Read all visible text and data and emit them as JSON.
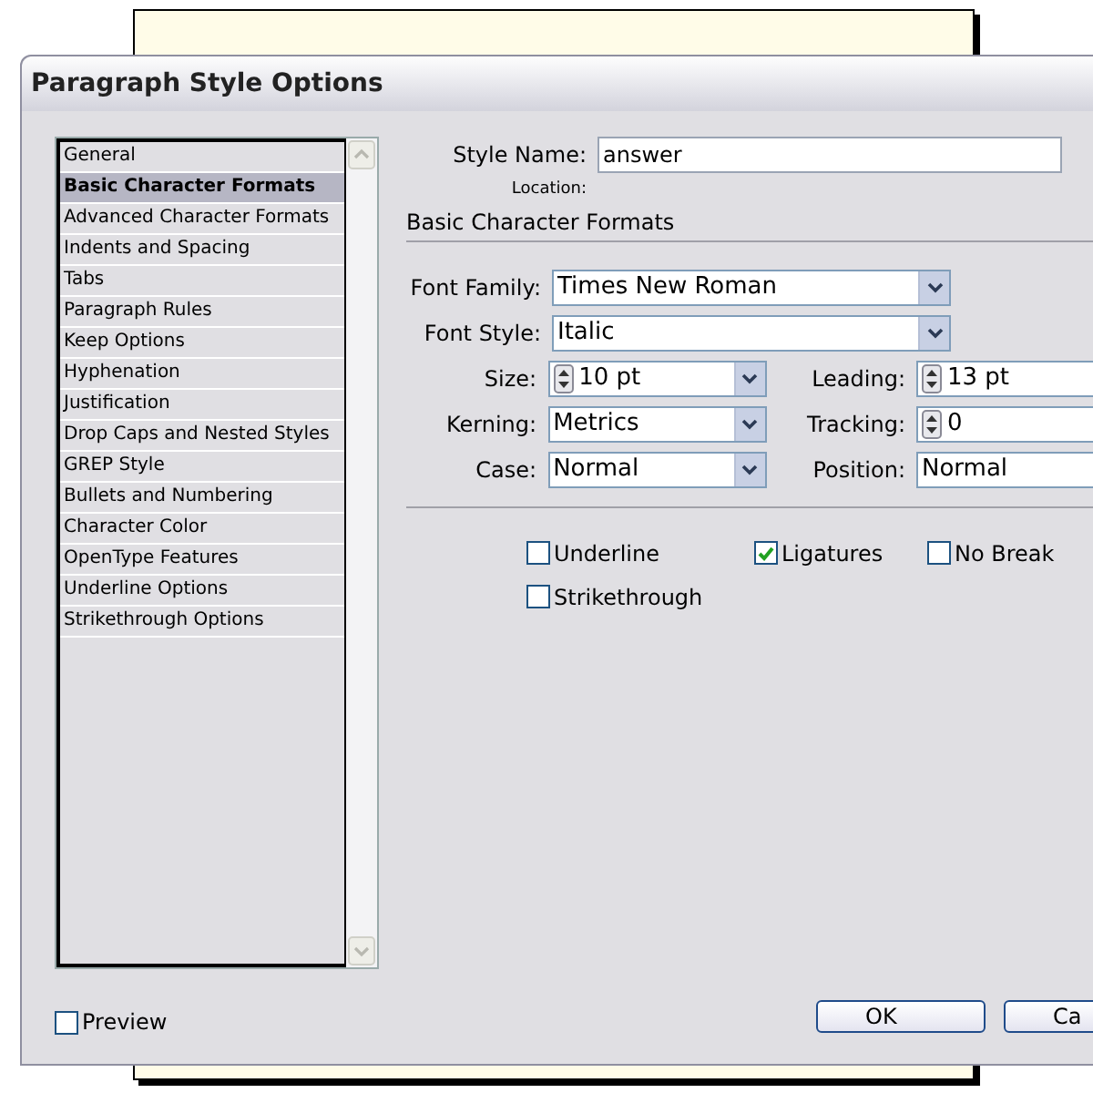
{
  "window": {
    "title": "Paragraph Style Options"
  },
  "categories": [
    {
      "label": "General",
      "selected": false
    },
    {
      "label": "Basic Character Formats",
      "selected": true
    },
    {
      "label": "Advanced Character Formats",
      "selected": false
    },
    {
      "label": "Indents and Spacing",
      "selected": false
    },
    {
      "label": "Tabs",
      "selected": false
    },
    {
      "label": "Paragraph Rules",
      "selected": false
    },
    {
      "label": "Keep Options",
      "selected": false
    },
    {
      "label": "Hyphenation",
      "selected": false
    },
    {
      "label": "Justification",
      "selected": false
    },
    {
      "label": "Drop Caps and Nested Styles",
      "selected": false
    },
    {
      "label": "GREP Style",
      "selected": false
    },
    {
      "label": "Bullets and Numbering",
      "selected": false
    },
    {
      "label": "Character Color",
      "selected": false
    },
    {
      "label": "OpenType Features",
      "selected": false
    },
    {
      "label": "Underline Options",
      "selected": false
    },
    {
      "label": "Strikethrough Options",
      "selected": false
    }
  ],
  "style_name": {
    "label": "Style Name:",
    "value": "answer"
  },
  "location": {
    "label": "Location:"
  },
  "section_title": "Basic Character Formats",
  "font_fields": [
    {
      "label": "Font Family:",
      "value": "Times New Roman"
    },
    {
      "label": "Font Style:",
      "value": "Italic"
    }
  ],
  "field_rows": [
    {
      "left": {
        "label": "Size:",
        "value": "10 pt",
        "kind": "spin-combo"
      },
      "right": {
        "label": "Leading:",
        "value": "13 pt",
        "kind": "spin"
      }
    },
    {
      "left": {
        "label": "Kerning:",
        "value": "Metrics",
        "kind": "combo"
      },
      "right": {
        "label": "Tracking:",
        "value": "0",
        "kind": "spin"
      }
    },
    {
      "left": {
        "label": "Case:",
        "value": "Normal",
        "kind": "combo"
      },
      "right": {
        "label": "Position:",
        "value": "Normal",
        "kind": "text"
      }
    }
  ],
  "options": [
    {
      "label": "Underline",
      "checked": false
    },
    {
      "label": "Ligatures",
      "checked": true
    },
    {
      "label": "No Break",
      "checked": false
    },
    {
      "label": "Strikethrough",
      "checked": false
    }
  ],
  "preview": {
    "label": "Preview",
    "checked": false
  },
  "buttons": [
    "OK",
    "Ca"
  ]
}
